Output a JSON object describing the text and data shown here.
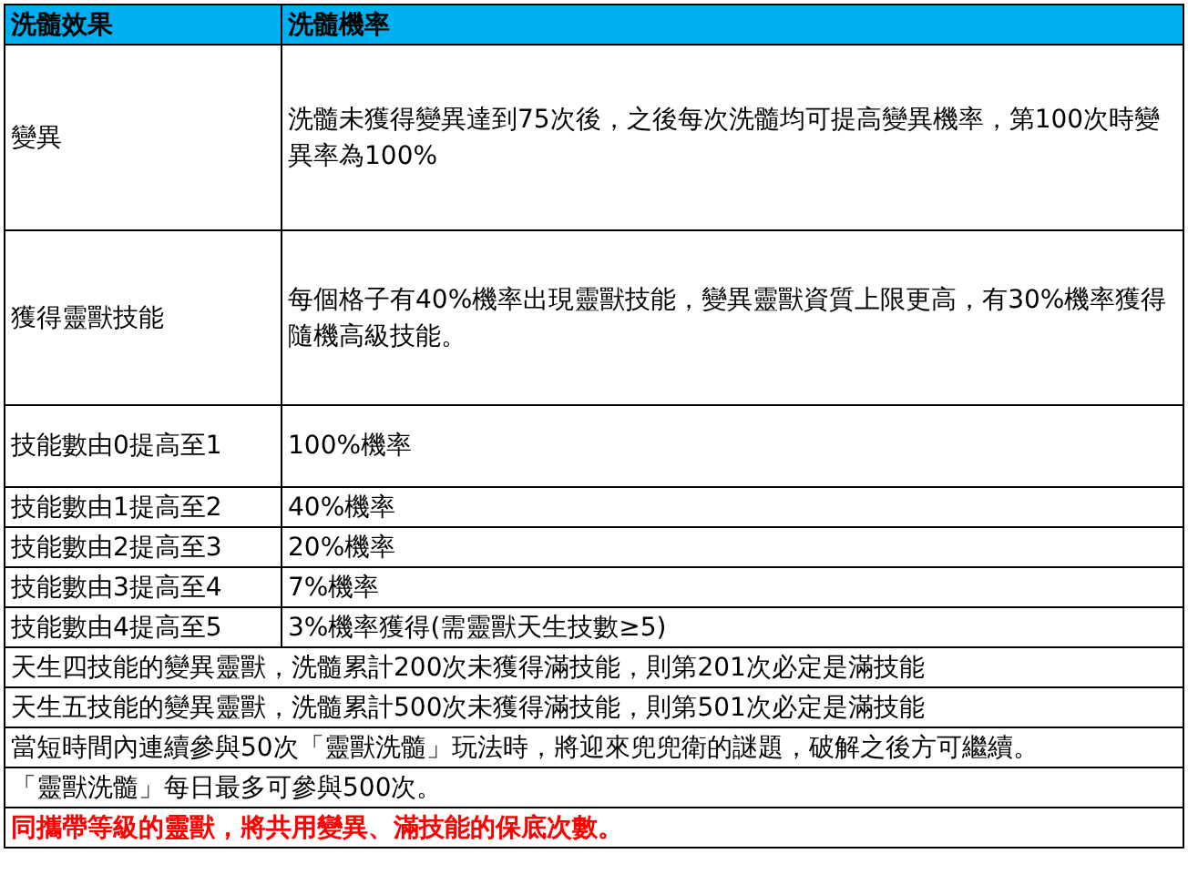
{
  "table": {
    "columns": [
      "洗髓效果",
      "洗髓機率"
    ],
    "rows": [
      {
        "kind": "pair",
        "cells": [
          "變異",
          "洗髓未獲得變異達到75次後，之後每次洗髓均可提高變異機率，第100次時變異率為100%"
        ]
      },
      {
        "kind": "pair",
        "cells": [
          "獲得靈獸技能",
          "每個格子有40%機率出現靈獸技能，變異靈獸資質上限更高，有30%機率獲得隨機高級技能。"
        ]
      },
      {
        "kind": "pair",
        "cells": [
          "技能數由0提高至1",
          "100%機率"
        ]
      },
      {
        "kind": "pair",
        "cells": [
          "技能數由1提高至2",
          "40%機率"
        ]
      },
      {
        "kind": "pair",
        "cells": [
          "技能數由2提高至3",
          "20%機率"
        ]
      },
      {
        "kind": "pair",
        "cells": [
          "技能數由3提高至4",
          "7%機率"
        ]
      },
      {
        "kind": "pair",
        "cells": [
          "技能數由4提高至5",
          "3%機率獲得(需靈獸天生技數≥5)"
        ]
      },
      {
        "kind": "note",
        "cells": [
          {
            "text": "天生四技能的變異靈獸，洗髓累計200次未獲得滿技能，則第201次必定是滿技能",
            "colspan": 2
          }
        ]
      },
      {
        "kind": "note",
        "cells": [
          {
            "text": "天生五技能的變異靈獸，洗髓累計500次未獲得滿技能，則第501次必定是滿技能",
            "colspan": 2
          }
        ]
      },
      {
        "kind": "note",
        "cells": [
          {
            "text": "當短時間內連續參與50次「靈獸洗髓」玩法時，將迎來兜兜衛的謎題，破解之後方可繼續。",
            "colspan": 2
          }
        ]
      },
      {
        "kind": "note",
        "cells": [
          {
            "text": "「靈獸洗髓」每日最多可參與500次。",
            "colspan": 2
          }
        ]
      },
      {
        "kind": "warning",
        "cells": [
          {
            "text": "同攜帶等級的靈獸，將共用變異、滿技能的保底次數。",
            "colspan": 2
          }
        ]
      }
    ]
  }
}
